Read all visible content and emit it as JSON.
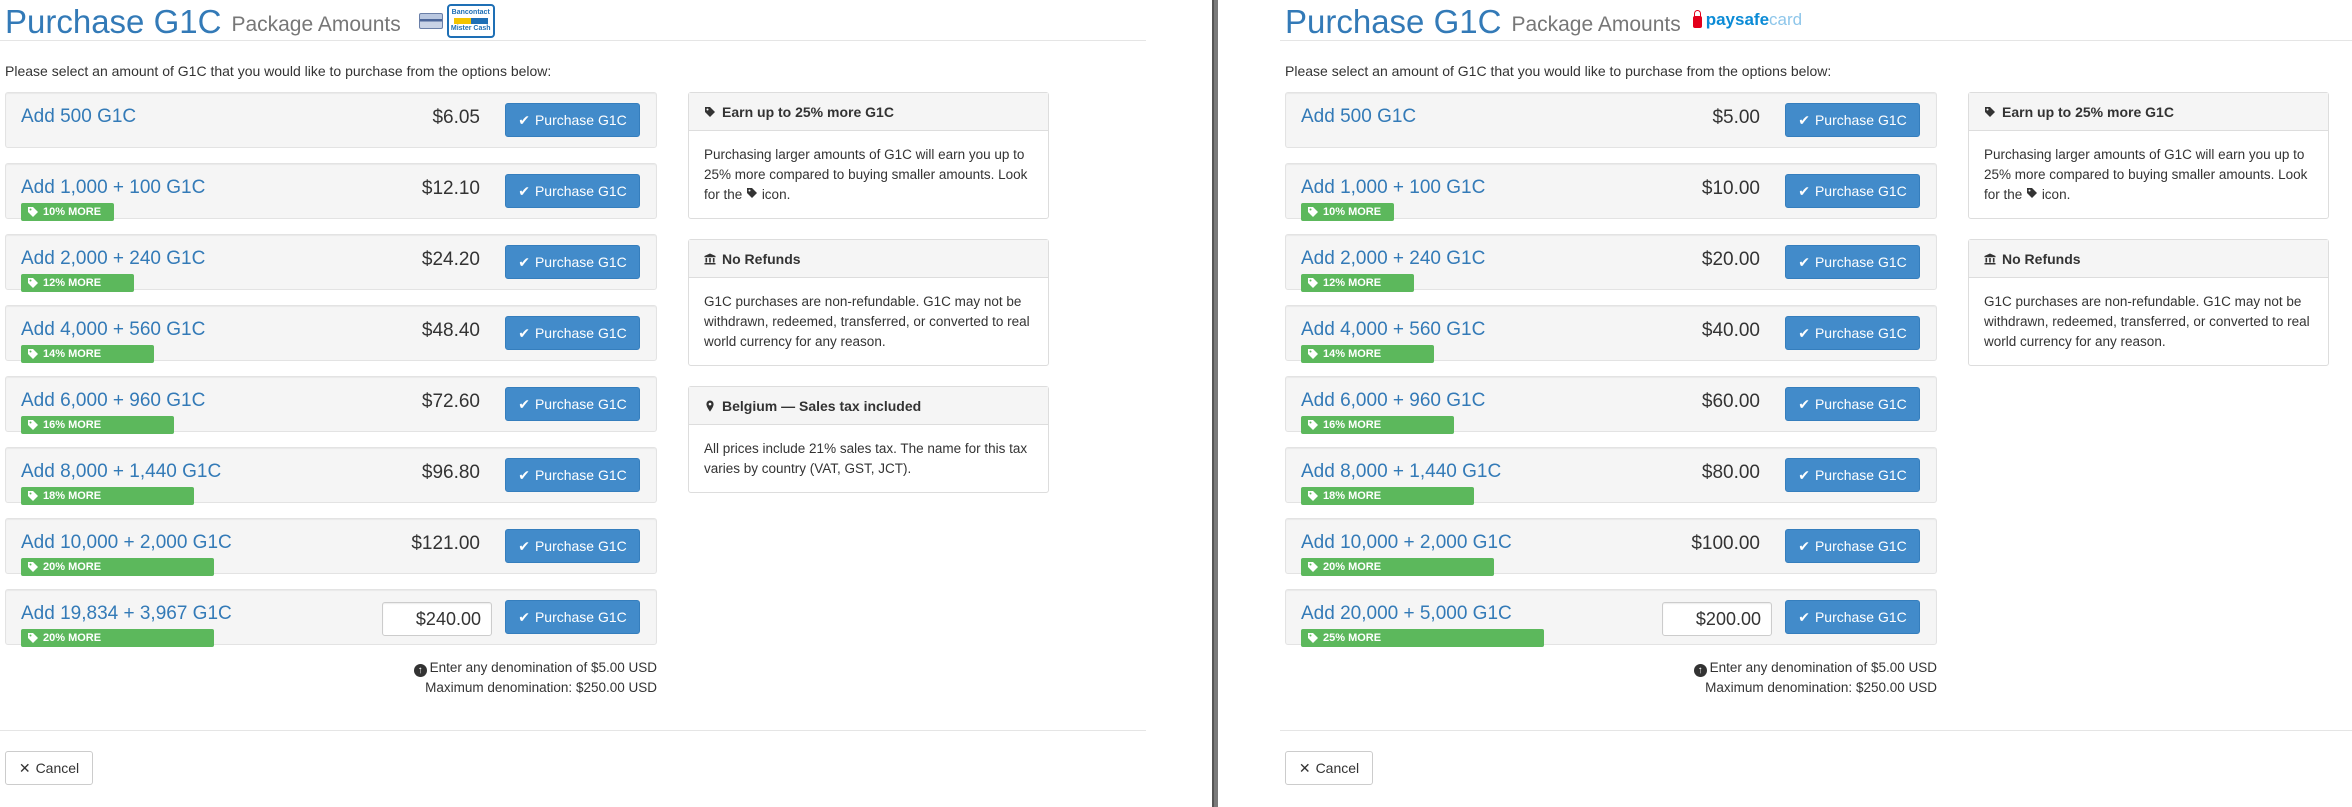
{
  "left": {
    "title": "Purchase G1C",
    "subtitle": "Package Amounts",
    "logo_text": [
      "Bancontact",
      "Mister Cash"
    ],
    "intro": "Please select an amount of G1C that you would like to purchase from the options below:",
    "packages": [
      {
        "title": "Add 500 G1C",
        "price": "$6.05",
        "badge": "",
        "button": "Purchase G1C"
      },
      {
        "title": "Add 1,000 + 100 G1C",
        "price": "$12.10",
        "badge": "10% MORE",
        "button": "Purchase G1C"
      },
      {
        "title": "Add 2,000 + 240 G1C",
        "price": "$24.20",
        "badge": "12% MORE",
        "button": "Purchase G1C"
      },
      {
        "title": "Add 4,000 + 560 G1C",
        "price": "$48.40",
        "badge": "14% MORE",
        "button": "Purchase G1C"
      },
      {
        "title": "Add 6,000 + 960 G1C",
        "price": "$72.60",
        "badge": "16% MORE",
        "button": "Purchase G1C"
      },
      {
        "title": "Add 8,000 + 1,440 G1C",
        "price": "$96.80",
        "badge": "18% MORE",
        "button": "Purchase G1C"
      },
      {
        "title": "Add 10,000 + 2,000 G1C",
        "price": "$121.00",
        "badge": "20% MORE",
        "button": "Purchase G1C"
      },
      {
        "title": "Add 19,834 + 3,967 G1C",
        "input_value": "$240.00",
        "badge": "20% MORE",
        "button": "Purchase G1C"
      }
    ],
    "note_line1": "Enter any denomination of $5.00 USD",
    "note_line2": "Maximum denomination: $250.00 USD",
    "side_boxes": [
      {
        "icon": "tag-icon",
        "heading": "Earn up to 25% more G1C",
        "body_before": "Purchasing larger amounts of G1C will earn you up to 25% more compared to buying smaller amounts. Look for the",
        "body_after": "icon."
      },
      {
        "icon": "bank-icon",
        "heading": "No Refunds",
        "body": "G1C purchases are non-refundable. G1C may not be withdrawn, redeemed, transferred, or converted to real world currency for any reason."
      },
      {
        "icon": "map-marker-icon",
        "heading": "Belgium — Sales tax included",
        "body": "All prices include 21% sales tax. The name for this tax varies by country (VAT, GST, JCT)."
      }
    ],
    "cancel": "Cancel"
  },
  "right": {
    "title": "Purchase G1C",
    "subtitle": "Package Amounts",
    "logo_text": [
      "paysafe",
      "card"
    ],
    "intro": "Please select an amount of G1C that you would like to purchase from the options below:",
    "packages": [
      {
        "title": "Add 500 G1C",
        "price": "$5.00",
        "badge": "",
        "button": "Purchase G1C"
      },
      {
        "title": "Add 1,000 + 100 G1C",
        "price": "$10.00",
        "badge": "10% MORE",
        "button": "Purchase G1C"
      },
      {
        "title": "Add 2,000 + 240 G1C",
        "price": "$20.00",
        "badge": "12% MORE",
        "button": "Purchase G1C"
      },
      {
        "title": "Add 4,000 + 560 G1C",
        "price": "$40.00",
        "badge": "14% MORE",
        "button": "Purchase G1C"
      },
      {
        "title": "Add 6,000 + 960 G1C",
        "price": "$60.00",
        "badge": "16% MORE",
        "button": "Purchase G1C"
      },
      {
        "title": "Add 8,000 + 1,440 G1C",
        "price": "$80.00",
        "badge": "18% MORE",
        "button": "Purchase G1C"
      },
      {
        "title": "Add 10,000 + 2,000 G1C",
        "price": "$100.00",
        "badge": "20% MORE",
        "button": "Purchase G1C"
      },
      {
        "title": "Add 20,000 + 5,000 G1C",
        "input_value": "$200.00",
        "badge": "25% MORE",
        "button": "Purchase G1C"
      }
    ],
    "note_line1": "Enter any denomination of $5.00 USD",
    "note_line2": "Maximum denomination: $250.00 USD",
    "side_boxes": [
      {
        "icon": "tag-icon",
        "heading": "Earn up to 25% more G1C",
        "body_before": "Purchasing larger amounts of G1C will earn you up to 25% more compared to buying smaller amounts. Look for the",
        "body_after": "icon."
      },
      {
        "icon": "bank-icon",
        "heading": "No Refunds",
        "body": "G1C purchases are non-refundable. G1C may not be withdrawn, redeemed, transferred, or converted to real world currency for any reason."
      }
    ],
    "cancel": "Cancel"
  },
  "colors": {
    "link": "#337ab7",
    "primary": "#428bca",
    "success": "#5cb85c",
    "bancontact": "#1e6fb5",
    "paysafe_red": "#e3001b",
    "paysafe_blue": "#0b8bd6"
  }
}
